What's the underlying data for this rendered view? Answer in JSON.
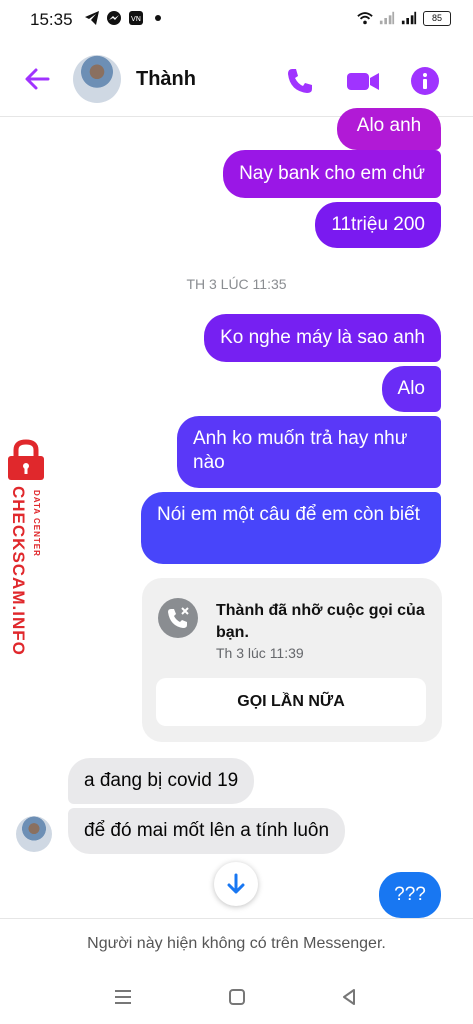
{
  "status_bar": {
    "time": "15:35",
    "left_icons": [
      "telegram-icon",
      "messenger-icon",
      "vn-app-icon",
      "dot-icon"
    ],
    "right_icons": [
      "wifi-icon",
      "signal-icon",
      "signal-icon"
    ],
    "battery": "85"
  },
  "header": {
    "contact_name": "Thành",
    "icons": [
      "back-arrow-icon",
      "phone-icon",
      "video-camera-icon",
      "info-icon"
    ],
    "accent_color": "#a033ff"
  },
  "messages": {
    "m1": "Alo anh",
    "m2": "Nay bank cho em chứ",
    "m3": "11triệu 200",
    "timestamp": "TH 3 LÚC 11:35",
    "m4": "Ko nghe máy là sao anh",
    "m5": "Alo",
    "m6": "Anh ko muốn trả hay như nào",
    "m7": "Nói em một câu để em còn biết",
    "m8": "a đang bị covid 19",
    "m9": "để đó mai mốt lên a tính luôn",
    "m10": "???"
  },
  "call_card": {
    "title": "Thành đã nhỡ cuộc gọi của bạn.",
    "time": "Th 3 lúc 11:39",
    "button": "GỌI LẦN NỮA",
    "icon": "missed-call-icon"
  },
  "watermark": {
    "brand": "CHECKSCAM.INFO",
    "subtitle": "DATA CENTER",
    "color": "#e0282c"
  },
  "footer": {
    "notice": "Người này hiện không có trên Messenger."
  },
  "nav_bar": {
    "icons": [
      "menu-icon",
      "home-icon",
      "back-icon"
    ]
  }
}
